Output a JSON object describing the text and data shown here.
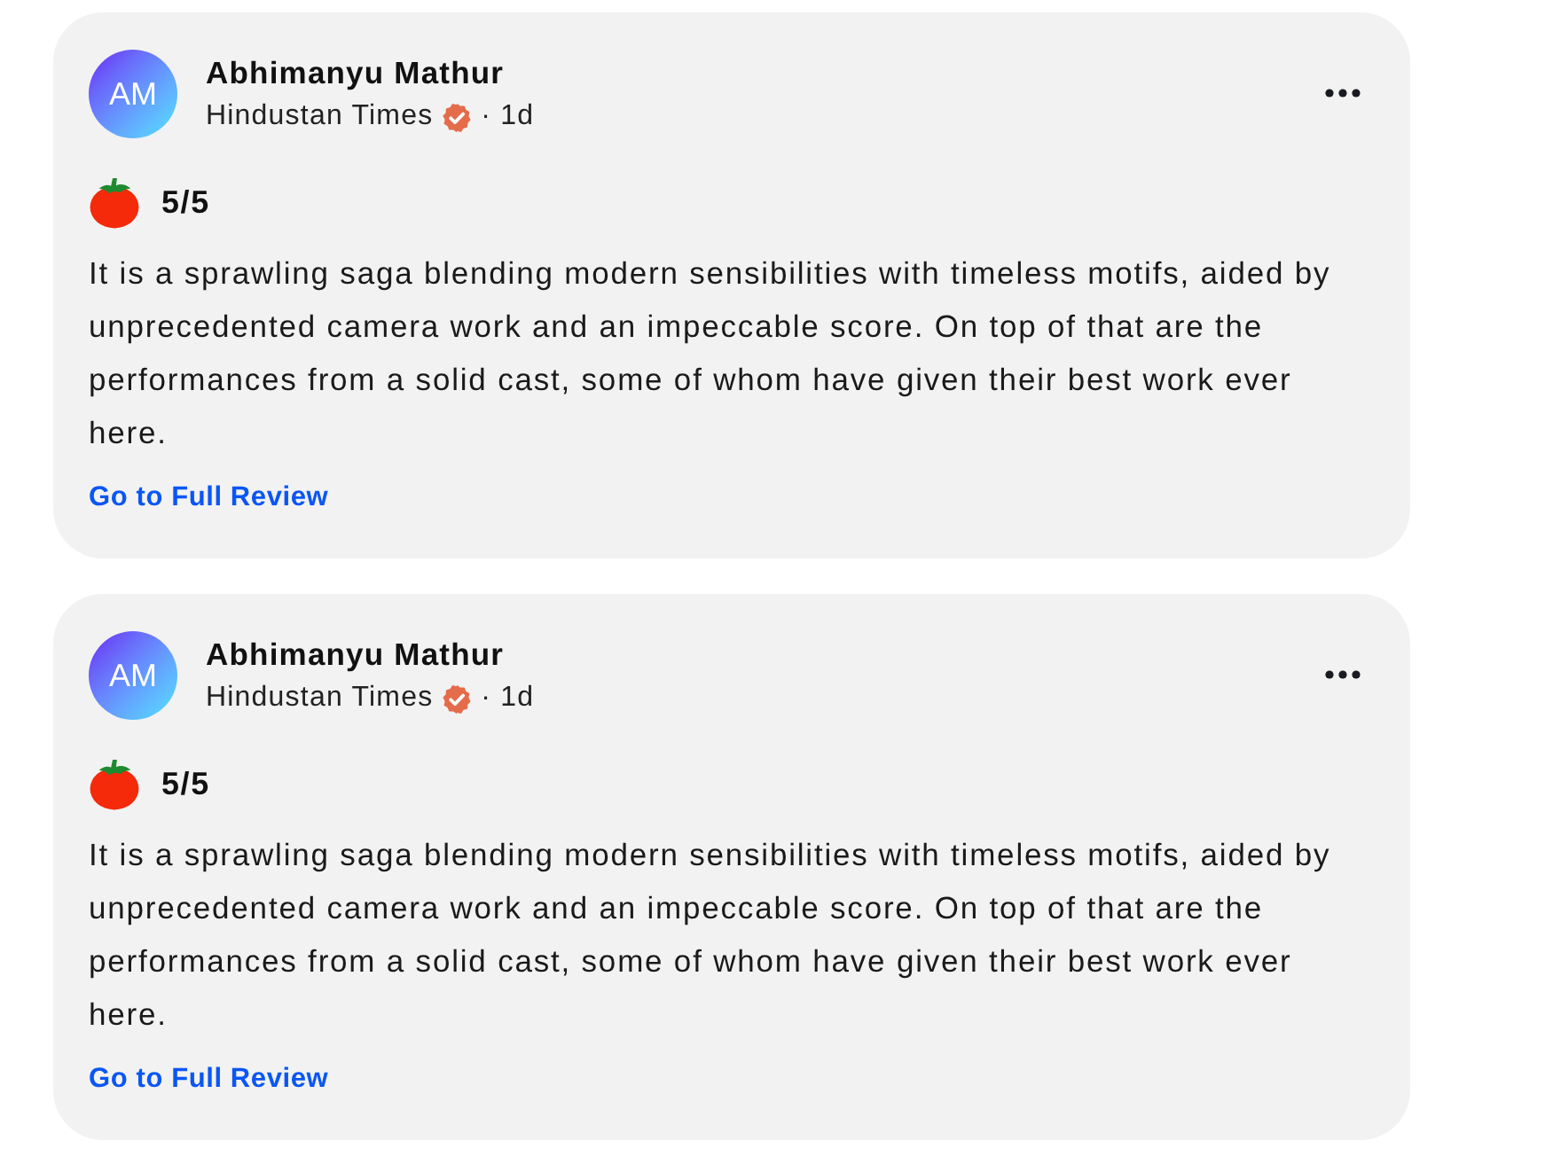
{
  "reviews": [
    {
      "author": {
        "initials": "AM",
        "name": "Abhimanyu Mathur"
      },
      "publication": "Hindustan Times",
      "verified": true,
      "time": "· 1d",
      "rating": "5/5",
      "text": "It is a sprawling saga blending modern sensibilities with timeless motifs, aided by unprecedented camera work and an impeccable score. On top of that are the performances from a solid cast, some of whom have given their best work ever here.",
      "link": "Go to Full Review"
    },
    {
      "author": {
        "initials": "AM",
        "name": "Abhimanyu Mathur"
      },
      "publication": "Hindustan Times",
      "verified": true,
      "time": "· 1d",
      "rating": "5/5",
      "text": "It is a sprawling saga blending modern sensibilities with timeless motifs, aided by unprecedented camera work and an impeccable score. On top of that are the performances from a solid cast, some of whom have given their best work ever here.",
      "link": "Go to Full Review"
    }
  ]
}
